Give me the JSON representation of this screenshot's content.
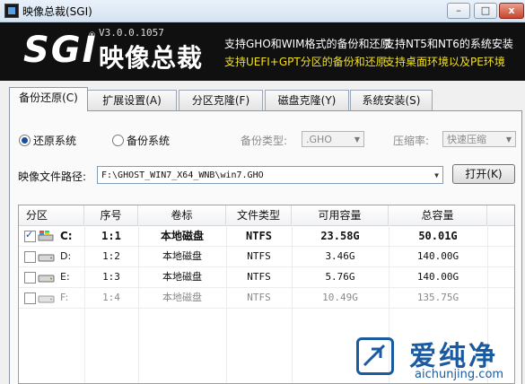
{
  "window": {
    "title": "映像总裁(SGI)",
    "min": "–",
    "max": "□",
    "close": "x"
  },
  "banner": {
    "logo_text": "SGI",
    "logo_mark": "®",
    "logo_cn": "映像总裁",
    "version": "V3.0.0.1057",
    "features": [
      {
        "text": "支持GHO和WIM格式的备份和还原",
        "color": "white"
      },
      {
        "text": "支持NT5和NT6的系统安装",
        "color": "white"
      },
      {
        "text": "支持UEFI+GPT分区的备份和还原",
        "color": "yellow"
      },
      {
        "text": "支持桌面环境以及PE环境",
        "color": "yellow"
      }
    ],
    "colors": {
      "background": "#101010",
      "white_text": "#ffffff",
      "yellow_text": "#f3e21a"
    }
  },
  "tabs": [
    {
      "label": "备份还原(C)",
      "active": true
    },
    {
      "label": "扩展设置(A)",
      "active": false
    },
    {
      "label": "分区克隆(F)",
      "active": false
    },
    {
      "label": "磁盘克隆(Y)",
      "active": false
    },
    {
      "label": "系统安装(S)",
      "active": false
    }
  ],
  "mode": {
    "restore_label": "还原系统",
    "backup_label": "备份系统",
    "selected": "还原系统",
    "backup_type_label": "备份类型:",
    "backup_type_value": ".GHO",
    "compression_label": "压缩率:",
    "compression_value": "快速压缩"
  },
  "image_path": {
    "label": "映像文件路径:",
    "value": "F:\\GHOST_WIN7_X64_WNB\\win7.GHO",
    "open_button": "打开(K)"
  },
  "table": {
    "headers": [
      "分区",
      "序号",
      "卷标",
      "文件类型",
      "可用容量",
      "总容量"
    ],
    "rows": [
      {
        "checked": true,
        "drive": "C:",
        "index": "1:1",
        "label": "本地磁盘",
        "fs": "NTFS",
        "free": "23.58G",
        "total": "50.01G",
        "bold": true,
        "dim": false
      },
      {
        "checked": false,
        "drive": "D:",
        "index": "1:2",
        "label": "本地磁盘",
        "fs": "NTFS",
        "free": "3.46G",
        "total": "140.00G",
        "bold": false,
        "dim": false
      },
      {
        "checked": false,
        "drive": "E:",
        "index": "1:3",
        "label": "本地磁盘",
        "fs": "NTFS",
        "free": "5.76G",
        "total": "140.00G",
        "bold": false,
        "dim": false
      },
      {
        "checked": false,
        "drive": "F:",
        "index": "1:4",
        "label": "本地磁盘",
        "fs": "NTFS",
        "free": "10.49G",
        "total": "135.75G",
        "bold": false,
        "dim": true
      }
    ]
  },
  "watermark": {
    "cn": "爱纯净",
    "url": "aichunjing.com",
    "color": "#1a5aa0"
  }
}
